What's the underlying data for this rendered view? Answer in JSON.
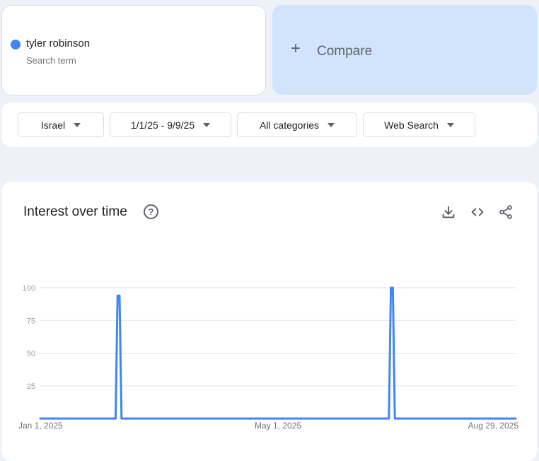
{
  "term": {
    "name": "tyler robinson",
    "sublabel": "Search term",
    "color": "#4285f4"
  },
  "compare": {
    "label": "Compare"
  },
  "filters": [
    {
      "label": "Israel"
    },
    {
      "label": "1/1/25 - 9/9/25"
    },
    {
      "label": "All categories"
    },
    {
      "label": "Web Search"
    }
  ],
  "chart_section": {
    "title": "Interest over time",
    "icons": [
      "help-icon",
      "download-icon",
      "embed-code-icon",
      "share-icon"
    ]
  },
  "chart_data": {
    "type": "line",
    "title": "Interest over time",
    "xlabel": "",
    "ylabel": "",
    "ylim": [
      0,
      100
    ],
    "y_ticks": [
      25,
      50,
      75,
      100
    ],
    "x_tick_labels": [
      "Jan 1, 2025",
      "May 1, 2025",
      "Aug 29, 2025"
    ],
    "x": [
      "2025-01-01",
      "2025-02-08",
      "2025-02-09",
      "2025-02-10",
      "2025-02-11",
      "2025-06-26",
      "2025-06-27",
      "2025-06-28",
      "2025-06-29",
      "2025-08-29"
    ],
    "series": [
      {
        "values": [
          0,
          0,
          94,
          94,
          0,
          0,
          100,
          100,
          0,
          0
        ],
        "color": "#4285f4"
      }
    ],
    "grid": true,
    "legend": "none"
  }
}
